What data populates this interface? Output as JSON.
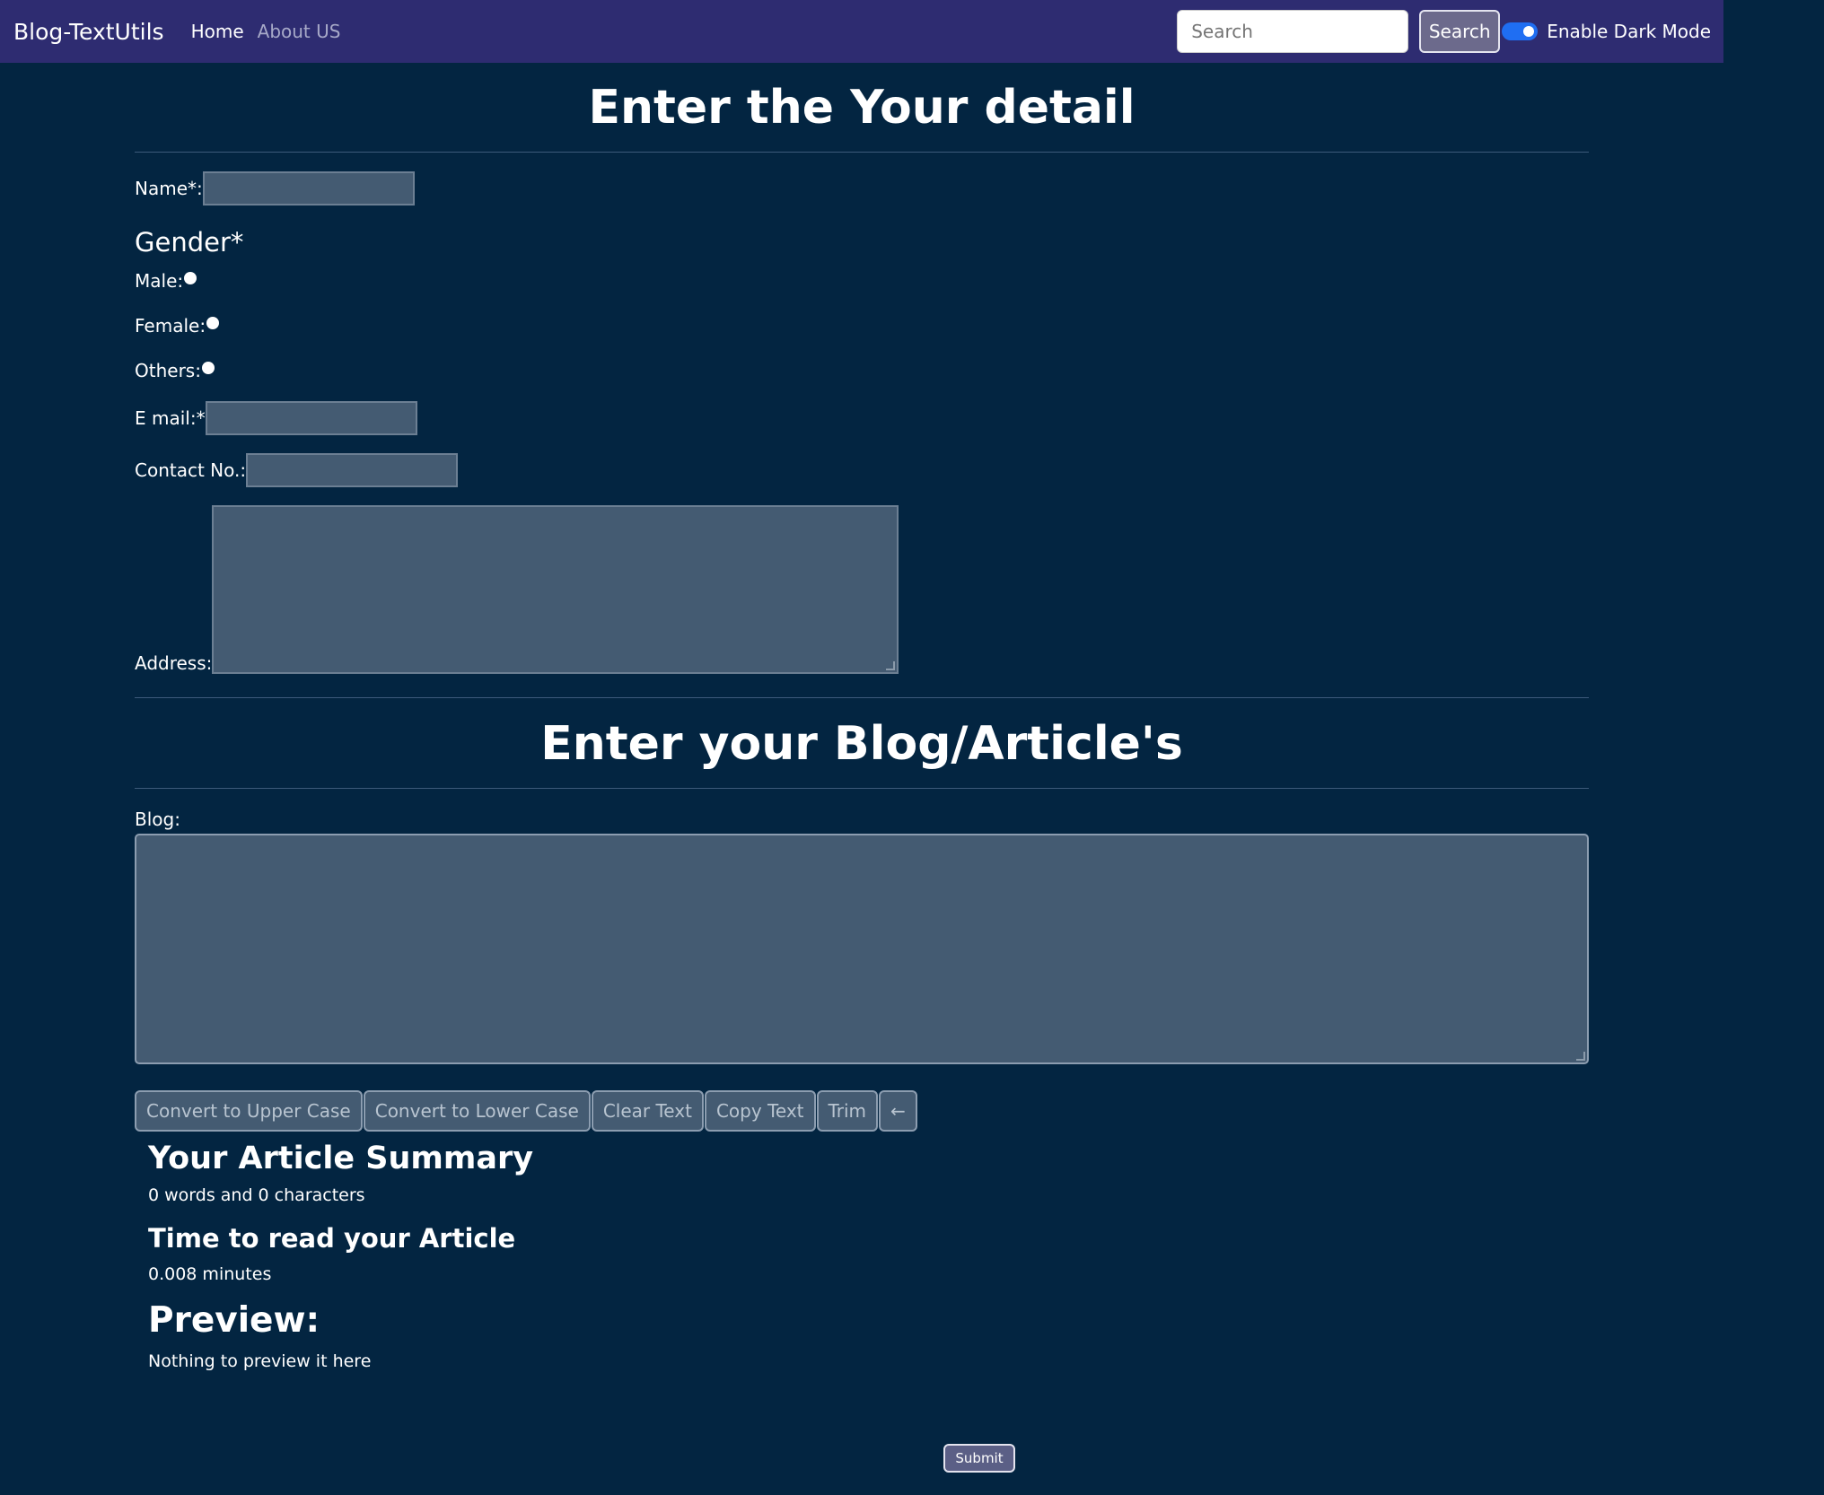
{
  "navbar": {
    "brand": "Blog-TextUtils",
    "links": [
      "Home",
      "About US"
    ],
    "search_placeholder": "Search",
    "search_button": "Search",
    "dark_mode_label": "Enable Dark Mode",
    "dark_mode_enabled": true
  },
  "details": {
    "title": "Enter the Your detail",
    "name_label": "Name*:",
    "gender_title": "Gender*",
    "gender_options": [
      "Male:",
      "Female:",
      "Others:"
    ],
    "email_label": "E mail:*",
    "contact_label": "Contact No.:",
    "address_label": "Address:"
  },
  "blog": {
    "title": "Enter your Blog/Article's",
    "label": "Blog:",
    "buttons": [
      "Convert to Upper Case",
      "Convert to Lower Case",
      "Clear Text",
      "Copy Text",
      "Trim",
      "←"
    ]
  },
  "summary": {
    "title": "Your Article Summary",
    "counts": "0 words and 0 characters",
    "time_title": "Time to read your Article",
    "time_value": "0.008 minutes",
    "preview_title": "Preview:",
    "preview_text": "Nothing to preview it here"
  },
  "submit_label": "Submit",
  "colors": {
    "page_bg": "#032541",
    "navbar_bg": "#2e2c71",
    "input_bg": "#445b72",
    "toggle_on": "#1f6ef2"
  }
}
